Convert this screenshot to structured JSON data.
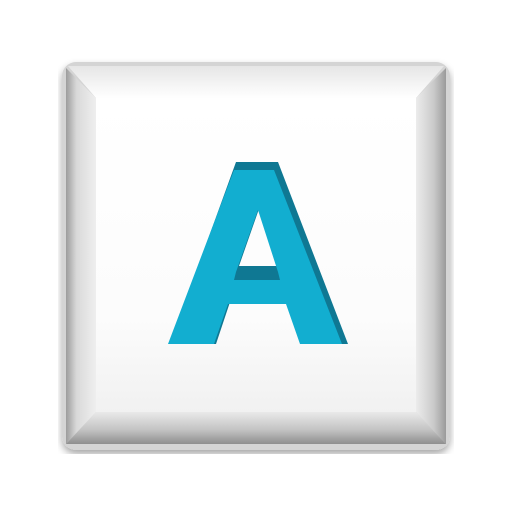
{
  "key": {
    "legend": "A",
    "colors": {
      "legend_face": "#12aed0",
      "legend_shadow": "#0f7893",
      "cap_top": "#ffffff",
      "cap_rim": "#d6d6d6",
      "cap_side_dark": "#9a9a9a",
      "cap_side_light": "#f2f2f2"
    }
  }
}
